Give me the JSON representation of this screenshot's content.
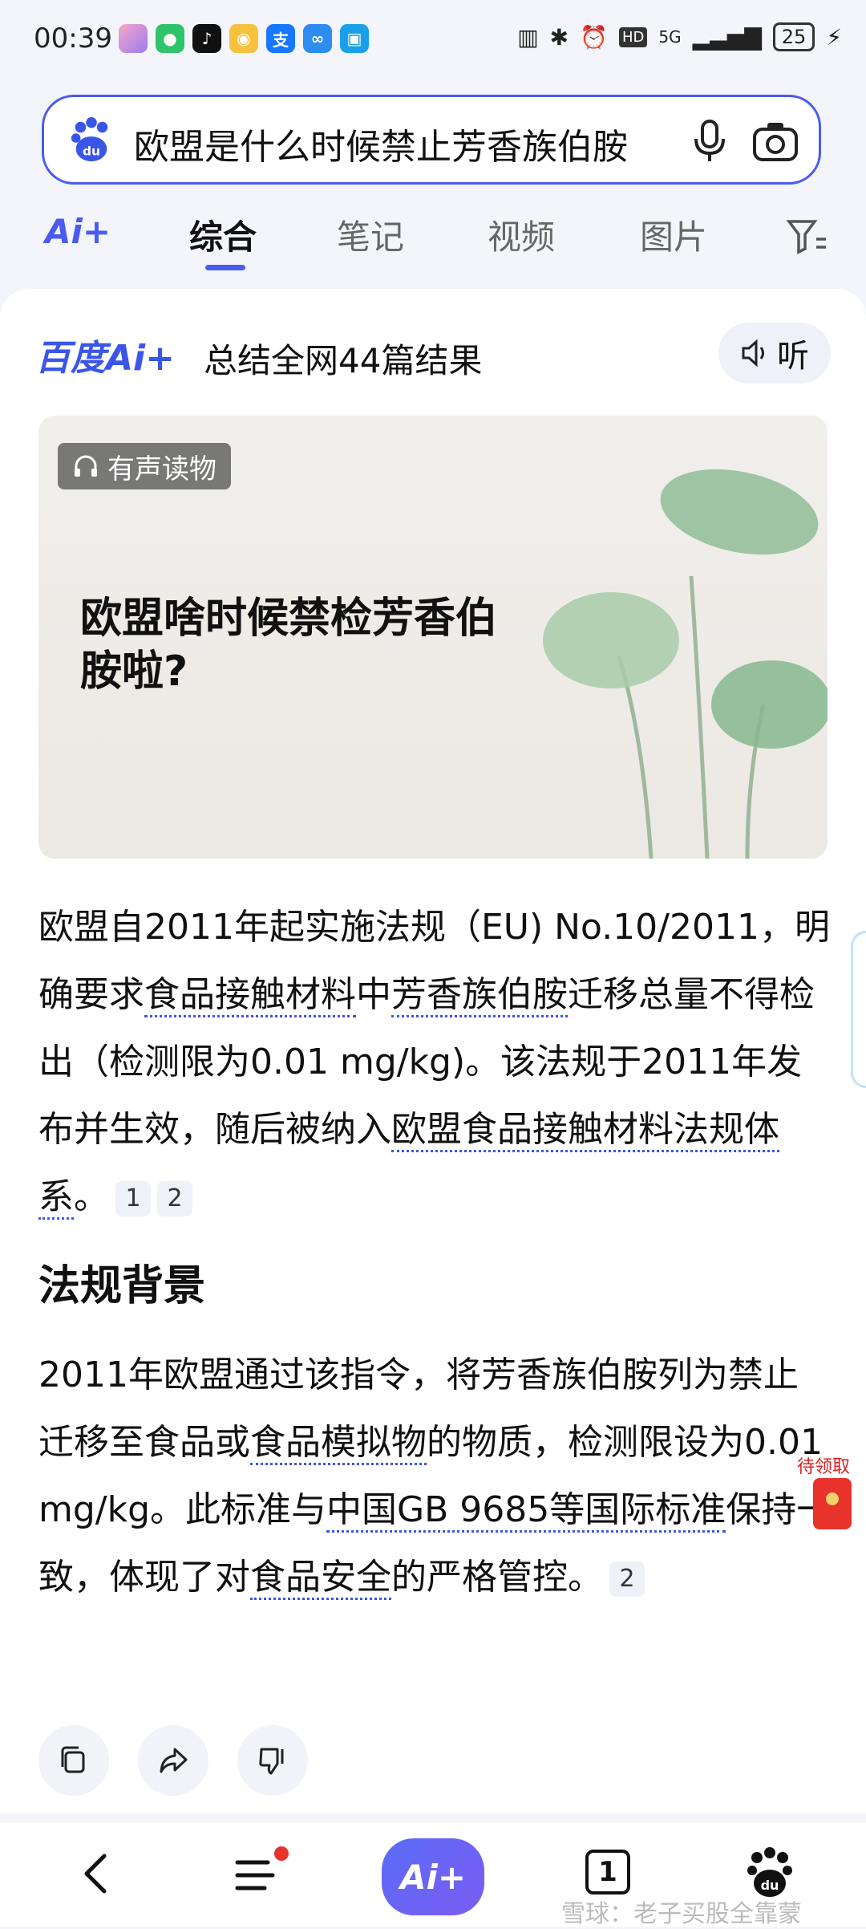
{
  "status_bar": {
    "time": "00:39",
    "signal_label": "5G",
    "battery": "25",
    "hd_label": "HD"
  },
  "search": {
    "query": "欧盟是什么时候禁止芳香族伯胺"
  },
  "tabs": {
    "ai": "Ai+",
    "items": [
      "综合",
      "笔记",
      "视频",
      "图片"
    ]
  },
  "ai_card": {
    "logo": "百度Ai+",
    "summary": "总结全网44篇结果",
    "listen": "听",
    "audio_badge": "有声读物",
    "audio_title": "欧盟啥时候禁检芳香伯胺啦?",
    "para1": {
      "t1": "欧盟自2011年起实施法规（EU) No.10/2011，明确要求",
      "u1": "食品接触材料",
      "t2": "中",
      "u2": "芳香族伯胺",
      "t3": "迁移总量不得检出（检测限为0.01 mg/kg)。该法规于2011年发布并生效，随后被纳入",
      "u3": "欧盟食品接触材料法规体系",
      "t4": "。",
      "cite1": "1",
      "cite2": "2"
    },
    "section_title": "法规背景",
    "para2": {
      "t1": "2011年欧盟通过该指令，将芳香族伯胺列为禁止迁移至食品或",
      "u1": "食品模拟物",
      "t2": "的物质，检测限设为0.01 mg/kg。此标准与",
      "u2": "中国GB 9685等国际标准",
      "t3": "保持一致，体现了对",
      "u3": "食品安全",
      "t4": "的严格管控。",
      "cite1": "2"
    }
  },
  "redpacket_label": "待领取",
  "bottom_nav": {
    "ai": "Ai+",
    "tab_count": "1"
  },
  "watermark": "雪球：老子买股全靠蒙"
}
